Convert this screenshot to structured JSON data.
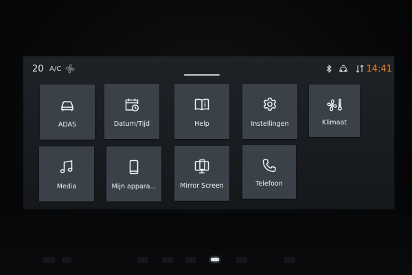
{
  "status_bar": {
    "temperature": "20",
    "ac_label": "A/C",
    "time": "14:41"
  },
  "tiles": [
    {
      "label": "ADAS",
      "icon": "car-icon"
    },
    {
      "label": "Datum/Tijd",
      "icon": "calendar-clock-icon"
    },
    {
      "label": "Help",
      "icon": "book-info-icon"
    },
    {
      "label": "Instellingen",
      "icon": "gear-icon"
    },
    {
      "label": "Klimaat",
      "icon": "fan-thermometer-icon"
    },
    {
      "label": "Media",
      "icon": "music-note-icon"
    },
    {
      "label": "Mijn appara...",
      "icon": "smartphone-icon"
    },
    {
      "label": "Mirror Screen",
      "icon": "mirror-screen-icon"
    },
    {
      "label": "Telefoon",
      "icon": "phone-icon"
    }
  ],
  "colors": {
    "tile_bg": "#3b4149",
    "clock": "#ff8a2b",
    "text": "#f0f2f4"
  }
}
